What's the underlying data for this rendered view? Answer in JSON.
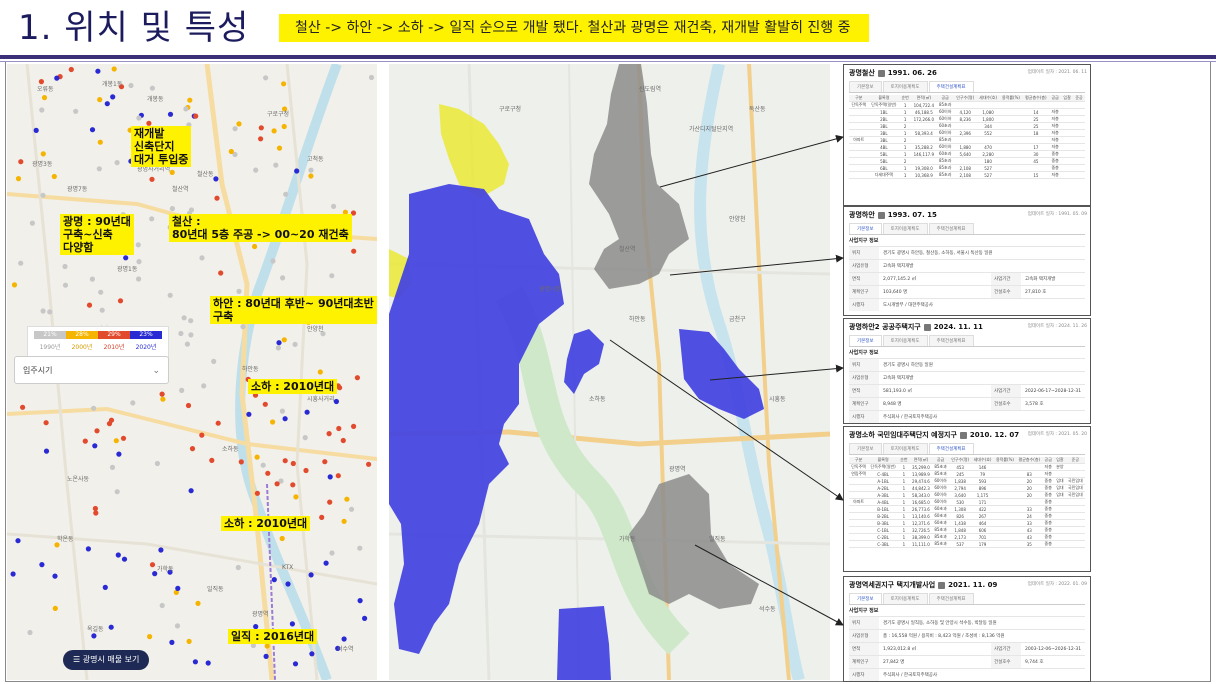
{
  "slide": {
    "title": "1. 위치 및 특성",
    "subtitle": "철산 -> 하안 -> 소하 -> 일직 순으로 개발 됐다. 철산과 광명은 재건축, 재개발 활발히 진행 중"
  },
  "left_map": {
    "callouts": [
      {
        "id": "redev",
        "text": "재개발\n신축단지\n대거 투입중"
      },
      {
        "id": "gwangmyeong",
        "text": "광명 : 90년대\n구축~신축\n다양함"
      },
      {
        "id": "cheolsan",
        "text": "철산 :\n80년대 5층 주공 -> 00~20 재건축"
      },
      {
        "id": "haan",
        "text": "하안 : 80년대 후반~ 90년대초반 구축"
      },
      {
        "id": "soha1",
        "text": "소하 : 2010년대"
      },
      {
        "id": "soha2",
        "text": "소하 : 2010년대"
      },
      {
        "id": "iljik",
        "text": "일직 : 2016년대"
      }
    ],
    "legend": {
      "percents": [
        "21%",
        "28%",
        "29%",
        "23%"
      ],
      "years": [
        "1990년",
        "2000년",
        "2010년",
        "2020년"
      ],
      "colors": [
        "#c7c7c7",
        "#f5b400",
        "#e24a2e",
        "#2a2ad4"
      ]
    },
    "filter_label": "입주시기",
    "button_label": "☰ 광명시 매물 보기",
    "place_labels": [
      "오류동",
      "개봉1동",
      "개봉동",
      "광명7동",
      "광명3동",
      "광명1동",
      "광명동",
      "철산역",
      "철산동",
      "하안동",
      "소하동",
      "일직동",
      "광명역",
      "가학동",
      "안양천",
      "학온동",
      "노온사동",
      "구로구청",
      "고척동",
      "광명사거리역",
      "석수역",
      "시흥사거리",
      "KTX",
      "옥길동"
    ]
  },
  "right_map": {
    "place_labels": [
      "구로구청",
      "신도림역",
      "안양천",
      "광명시청",
      "철산역",
      "하안동",
      "가산디지털단지역",
      "금천구",
      "광명역",
      "소하동",
      "시흥동",
      "독산동",
      "석수동",
      "가학동",
      "일직동"
    ]
  },
  "panels": [
    {
      "title": "광명철산 🗎 1991. 06. 26",
      "name": "광명철산",
      "date": "1991. 06. 26",
      "updated": "업데이트 일자 : 2021. 06. 11",
      "tabs": [
        "기본정보",
        "토지이용계획도",
        "주택건설계획표"
      ],
      "headers": [
        "구분",
        "블록명",
        "순번",
        "면적(㎡)",
        "공급",
        "인구수(명)",
        "세대수(호)",
        "용적률(%)",
        "평균층수(층)",
        "공급",
        "입찰",
        "준공"
      ],
      "rows": [
        [
          "단독주택",
          "단독주택(일반)",
          "1",
          "104,722.4",
          "85초과",
          "",
          "",
          "",
          "",
          "",
          "",
          ""
        ],
        [
          "",
          "1BL",
          "1",
          "46,188.5",
          "60이하",
          "4,120",
          "1,080",
          "",
          "14",
          "저층",
          "",
          ""
        ],
        [
          "",
          "2BL",
          "1",
          "172,266.0",
          "60이하",
          "8,236",
          "1,800",
          "",
          "25",
          "저층",
          "",
          ""
        ],
        [
          "",
          "3BL",
          "2",
          "",
          "60초과",
          "",
          "344",
          "",
          "25",
          "저층",
          "",
          ""
        ],
        [
          "",
          "3BL",
          "1",
          "58,393.4",
          "60이하",
          "2,396",
          "552",
          "",
          "18",
          "저층",
          "",
          ""
        ],
        [
          "아파트",
          "3BL",
          "2",
          "",
          "85초과",
          "",
          "",
          "",
          "",
          "저층",
          "",
          ""
        ],
        [
          "",
          "4BL",
          "1",
          "35,288.2",
          "60이하",
          "1,880",
          "470",
          "",
          "17",
          "저층",
          "",
          ""
        ],
        [
          "",
          "5BL",
          "1",
          "146,117.9",
          "60초과",
          "5,640",
          "2,280",
          "",
          "30",
          "중층",
          "",
          ""
        ],
        [
          "",
          "5BL",
          "2",
          "",
          "85초과",
          "",
          "180",
          "",
          "45",
          "중층",
          "",
          ""
        ],
        [
          "",
          "6BL",
          "1",
          "19,308.0",
          "85초과",
          "2,108",
          "527",
          "",
          "",
          "중층",
          "",
          ""
        ],
        [
          "",
          "다세대주택",
          "1",
          "10,368.9",
          "85초과",
          "2,108",
          "527",
          "",
          "15",
          "저층",
          "",
          ""
        ]
      ]
    },
    {
      "title": "광명하안 🗎 1993. 07. 15",
      "name": "광명하안",
      "date": "1993. 07. 15",
      "updated": "업데이트 일자 : 1991. 05. 09",
      "tabs": [
        "기본정보",
        "토지이용계획도",
        "주택건설계획표"
      ],
      "section": "사업지구 정보",
      "fields": [
        {
          "k": "위치",
          "v": "경기도 광명시 하안동, 철산동, 소하동, 서울시 독산동 일원"
        },
        {
          "k": "사업유형",
          "v": "고속화 택지개발"
        },
        {
          "k": "면적",
          "v": "2,077,145.2 ㎡",
          "k2": "사업기간",
          "v2": "고속화 택지개발"
        },
        {
          "k": "계획인구",
          "v": "103,640 명",
          "k2": "건설호수",
          "v2": "27,810 호"
        },
        {
          "k": "시행자",
          "v": "도시개발부 / 대한주택공사"
        }
      ]
    },
    {
      "title": "광명하안2 공공주택지구 🗎 2024. 11. 11",
      "name": "광명하안2 공공주택지구",
      "date": "2024. 11. 11",
      "updated": "업데이트 일자 : 2024. 11. 26",
      "tabs": [
        "기본정보",
        "토지이용계획도",
        "주택건설계획표"
      ],
      "section": "사업지구 정보",
      "fields": [
        {
          "k": "위치",
          "v": "경기도 광명시 하안동 일원"
        },
        {
          "k": "사업유형",
          "v": "고속화 택지개발"
        },
        {
          "k": "면적",
          "v": "581,193.0 ㎡",
          "k2": "사업기간",
          "v2": "2022-06-17~2028-12-31"
        },
        {
          "k": "계획인구",
          "v": "8,948 명",
          "k2": "건설호수",
          "v2": "3,578 호"
        },
        {
          "k": "시행자",
          "v": "주식회사 / 한국토지주택공사"
        }
      ]
    },
    {
      "title": "광명소하 국민임대주택단지 예정지구 🗎 2010. 12. 07",
      "name": "광명소하 국민임대주택단지 예정지구",
      "date": "2010. 12. 07",
      "updated": "업데이트 일자 : 2021. 05. 20",
      "tabs": [
        "기본정보",
        "토지이용계획도",
        "주택건설계획표"
      ],
      "headers": [
        "구분",
        "블록명",
        "순번",
        "면적(㎡)",
        "공급",
        "인구수(명)",
        "세대수(호)",
        "용적률(%)",
        "평균층수(층)",
        "공급",
        "입찰",
        "준공"
      ],
      "rows": [
        [
          "단독주택",
          "단독주택(일반)",
          "1",
          "35,299.0",
          "85초과",
          "453",
          "146",
          "",
          "",
          "저층",
          "분양",
          ""
        ],
        [
          "연립주택",
          "C-4BL",
          "1",
          "13,989.9",
          "85초과",
          "245",
          "79",
          "",
          "83",
          "저층",
          "",
          ""
        ],
        [
          "",
          "A-1BL",
          "1",
          "29,474.6",
          "60이하",
          "1,838",
          "593",
          "",
          "20",
          "중층",
          "임대",
          "국민임대"
        ],
        [
          "",
          "A-2BL",
          "1",
          "44,842.3",
          "60이하",
          "2,794",
          "896",
          "",
          "20",
          "중층",
          "임대",
          "국민임대"
        ],
        [
          "",
          "A-3BL",
          "1",
          "58,343.0",
          "60이하",
          "3,640",
          "1,175",
          "",
          "20",
          "중층",
          "임대",
          "국민임대"
        ],
        [
          "아파트",
          "A-4BL",
          "1",
          "16,685.0",
          "60이하",
          "530",
          "171",
          "",
          "",
          "중층",
          "",
          ""
        ],
        [
          "",
          "B-1BL",
          "1",
          "26,773.6",
          "60초과",
          "1,308",
          "422",
          "",
          "33",
          "중층",
          "",
          ""
        ],
        [
          "",
          "B-2BL",
          "1",
          "13,140.6",
          "60초과",
          "826",
          "267",
          "",
          "24",
          "중층",
          "",
          ""
        ],
        [
          "",
          "B-3BL",
          "1",
          "12,371.6",
          "60초과",
          "1,438",
          "464",
          "",
          "33",
          "중층",
          "",
          ""
        ],
        [
          "",
          "C-1BL",
          "1",
          "32,726.5",
          "85초과",
          "1,848",
          "606",
          "",
          "43",
          "중층",
          "",
          ""
        ],
        [
          "",
          "C-2BL",
          "1",
          "38,399.0",
          "85초과",
          "2,173",
          "701",
          "",
          "43",
          "중층",
          "",
          ""
        ],
        [
          "",
          "C-3BL",
          "1",
          "11,111.0",
          "85초과",
          "537",
          "179",
          "",
          "35",
          "중층",
          "",
          ""
        ]
      ]
    },
    {
      "title": "광명역세권지구 택지개발사업 🗎 2021. 11. 09",
      "name": "광명역세권지구 택지개발사업",
      "date": "2021. 11. 09",
      "updated": "업데이트 일자 : 2022. 01. 09",
      "tabs": [
        "기본정보",
        "토지이용계획도",
        "주택건설계획표"
      ],
      "section": "사업지구 정보",
      "fields": [
        {
          "k": "위치",
          "v": "경기도 광명시 일직동, 소하동 및 안양시 석수동, 박달동 일원"
        },
        {
          "k": "사업유형",
          "v": "총 : 16,558 억원 / 용지비 : 8,423 억원 / 조성비 : 8,136 억원"
        },
        {
          "k": "면적",
          "v": "1,923,012.8 ㎡",
          "k2": "사업기간",
          "v2": "2003-12-06~2026-12-31"
        },
        {
          "k": "계획인구",
          "v": "27,842 명",
          "k2": "건설호수",
          "v2": "9,744 호"
        },
        {
          "k": "시행자",
          "v": "주식회사 / 한국토지주택공사"
        }
      ]
    }
  ]
}
